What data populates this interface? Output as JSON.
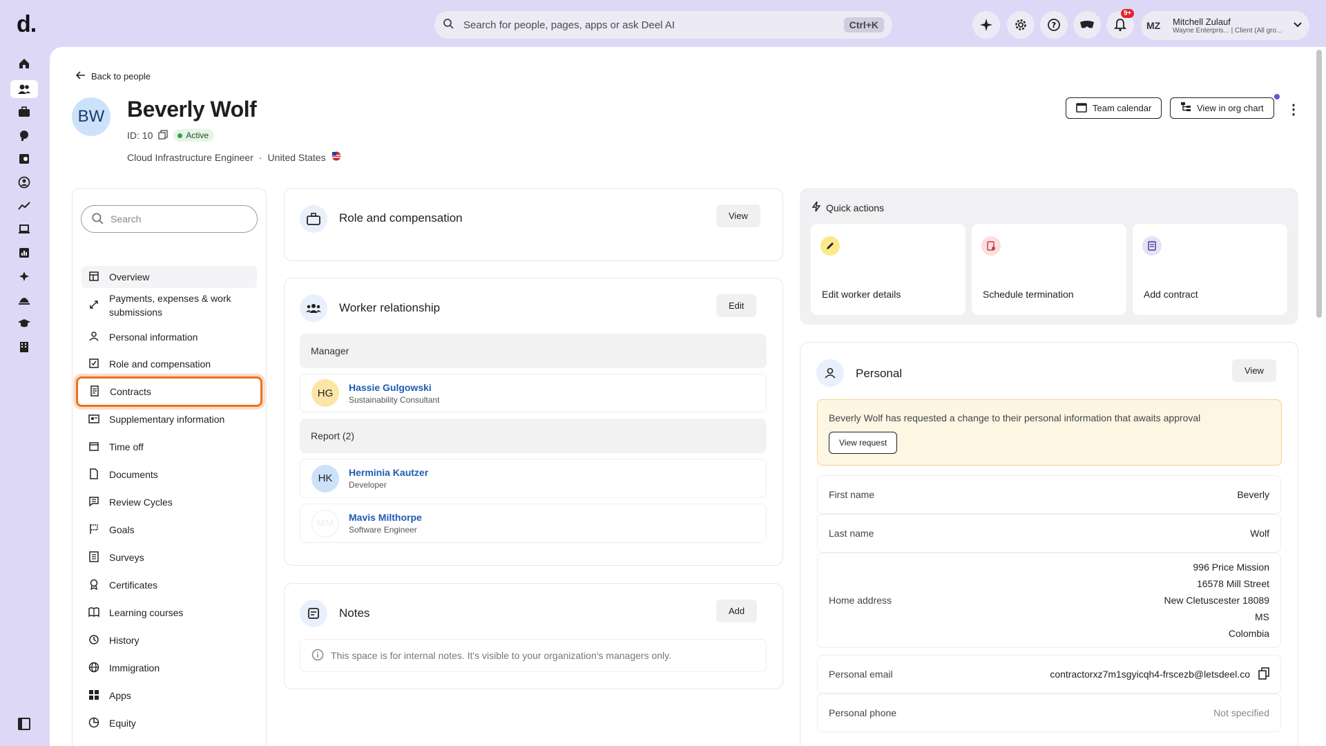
{
  "topbar": {
    "logo": "d.",
    "search_placeholder": "Search for people, pages, apps or ask Deel AI",
    "search_shortcut": "Ctrl+K",
    "notification_badge": "9+",
    "user": {
      "initials": "MZ",
      "name": "Mitchell Zulauf",
      "subtitle": "Wayne Enterpris... | Client (All gro..."
    }
  },
  "profile": {
    "back_label": "Back to people",
    "initials": "BW",
    "name": "Beverly Wolf",
    "id_label": "ID: 10",
    "status": "Active",
    "title": "Cloud Infrastructure Engineer",
    "separator": "·",
    "country": "United States",
    "team_calendar_label": "Team calendar",
    "org_chart_label": "View in org chart"
  },
  "sidebar": {
    "search_placeholder": "Search",
    "items": [
      {
        "label": "Overview",
        "icon": "layout-icon"
      },
      {
        "label": "Payments, expenses & work submissions",
        "icon": "arrows-icon"
      },
      {
        "label": "Personal information",
        "icon": "person-icon"
      },
      {
        "label": "Role and compensation",
        "icon": "checklist-icon"
      },
      {
        "label": "Contracts",
        "icon": "contract-icon"
      },
      {
        "label": "Supplementary information",
        "icon": "id-card-icon"
      },
      {
        "label": "Time off",
        "icon": "calendar-icon"
      },
      {
        "label": "Documents",
        "icon": "document-icon"
      },
      {
        "label": "Review Cycles",
        "icon": "chat-icon"
      },
      {
        "label": "Goals",
        "icon": "flag-icon"
      },
      {
        "label": "Surveys",
        "icon": "list-icon"
      },
      {
        "label": "Certificates",
        "icon": "certificate-icon"
      },
      {
        "label": "Learning courses",
        "icon": "book-icon"
      },
      {
        "label": "History",
        "icon": "history-icon"
      },
      {
        "label": "Immigration",
        "icon": "globe-icon"
      },
      {
        "label": "Apps",
        "icon": "apps-icon"
      },
      {
        "label": "Equity",
        "icon": "pie-icon"
      }
    ]
  },
  "role_card": {
    "title": "Role and compensation",
    "button": "View"
  },
  "worker_card": {
    "title": "Worker relationship",
    "button": "Edit",
    "manager_header": "Manager",
    "manager": {
      "initials": "HG",
      "name": "Hassie Gulgowski",
      "role": "Sustainability Consultant"
    },
    "report_header": "Report (2)",
    "reports": [
      {
        "initials": "HK",
        "name": "Herminia Kautzer",
        "role": "Developer"
      },
      {
        "initials": "MM",
        "name": "Mavis Milthorpe",
        "role": "Software Engineer"
      }
    ]
  },
  "notes_card": {
    "title": "Notes",
    "button": "Add",
    "info": "This space is for internal notes. It's visible to your organization's managers only."
  },
  "quick_actions": {
    "title": "Quick actions",
    "items": [
      {
        "label": "Edit worker details",
        "color": "#fbe98a"
      },
      {
        "label": "Schedule termination",
        "color": "#fbdede"
      },
      {
        "label": "Add contract",
        "color": "#e4e2f7"
      }
    ]
  },
  "personal": {
    "title": "Personal",
    "button": "View",
    "alert_text": "Beverly Wolf has requested a change to their personal information that awaits approval",
    "alert_button": "View request",
    "fields": {
      "first_name": {
        "label": "First name",
        "value": "Beverly"
      },
      "last_name": {
        "label": "Last name",
        "value": "Wolf"
      },
      "home_address": {
        "label": "Home address",
        "lines": [
          "996 Price Mission",
          "16578 Mill Street",
          "New Cletuscester 18089",
          "MS",
          "Colombia"
        ]
      },
      "personal_email": {
        "label": "Personal email",
        "value": "contractorxz7m1sgyicqh4-frscezb@letsdeel.co"
      },
      "personal_phone": {
        "label": "Personal phone",
        "value": "Not specified"
      }
    }
  },
  "colors": {
    "bg": "#ddd8f6",
    "focus": "#e8731f",
    "link": "#1f5bb3",
    "active": "#2fa64a"
  }
}
